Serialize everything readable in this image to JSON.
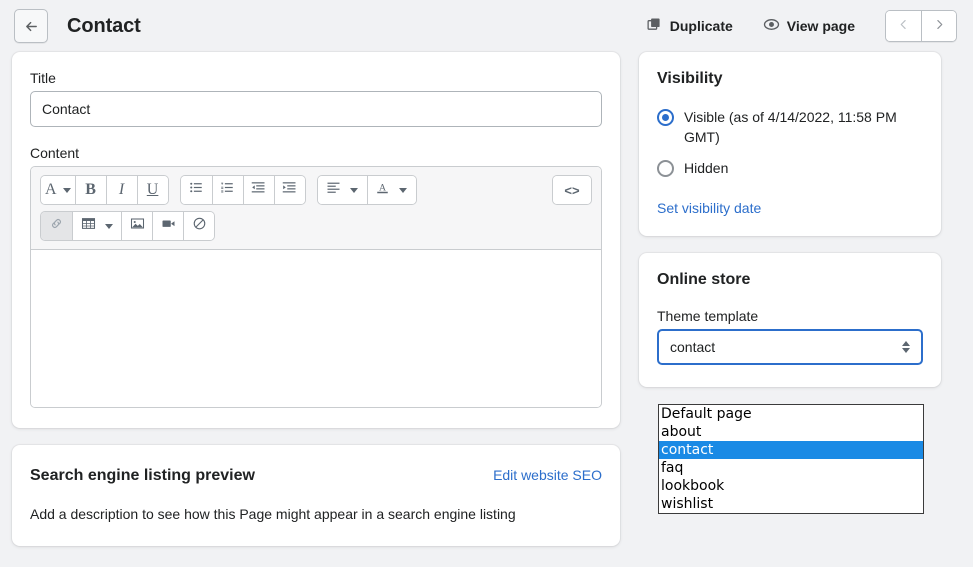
{
  "topbar": {
    "back_icon": "arrow-left-icon",
    "title": "Contact",
    "duplicate_label": "Duplicate",
    "duplicate_icon": "duplicate-icon",
    "view_page_label": "View page",
    "view_page_icon": "eye-icon",
    "prev_icon": "chevron-left-icon",
    "next_icon": "chevron-right-icon"
  },
  "main": {
    "title_label": "Title",
    "title_value": "Contact",
    "content_label": "Content",
    "editor": {
      "row1": [
        {
          "name": "font-style-button",
          "glyph": "A",
          "has_caret": true
        },
        {
          "name": "bold-button",
          "glyph": "B"
        },
        {
          "name": "italic-button",
          "glyph": "I"
        },
        {
          "name": "underline-button",
          "glyph": "U"
        },
        {
          "name": "bulleted-list-button",
          "glyph": "bulleted-list-icon"
        },
        {
          "name": "numbered-list-button",
          "glyph": "numbered-list-icon"
        },
        {
          "name": "outdent-button",
          "glyph": "outdent-icon"
        },
        {
          "name": "indent-button",
          "glyph": "indent-icon"
        },
        {
          "name": "align-button",
          "glyph": "align-left-icon",
          "has_caret": true
        },
        {
          "name": "text-color-button",
          "glyph": "text-color-icon",
          "has_caret": true
        },
        {
          "name": "code-view-button",
          "glyph": "<>"
        }
      ],
      "row2": [
        {
          "name": "insert-link-button",
          "glyph": "link-icon",
          "disabled": true
        },
        {
          "name": "insert-table-button",
          "glyph": "table-icon",
          "has_caret": true
        },
        {
          "name": "insert-image-button",
          "glyph": "image-icon"
        },
        {
          "name": "insert-video-button",
          "glyph": "video-icon"
        },
        {
          "name": "clear-formatting-button",
          "glyph": "no-symbol-icon"
        }
      ],
      "body_value": ""
    }
  },
  "seo": {
    "title": "Search engine listing preview",
    "edit_link": "Edit website SEO",
    "description": "Add a description to see how this Page might appear in a search engine listing"
  },
  "visibility": {
    "title": "Visibility",
    "options": [
      {
        "label": "Visible (as of 4/14/2022, 11:58 PM GMT)",
        "checked": true
      },
      {
        "label": "Hidden",
        "checked": false
      }
    ],
    "set_date_link": "Set visibility date"
  },
  "online_store": {
    "title": "Online store",
    "template_label": "Theme template",
    "template_value": "contact",
    "template_options": [
      "Default page",
      "about",
      "contact",
      "faq",
      "lookbook",
      "wishlist"
    ],
    "selected_option": "contact"
  },
  "colors": {
    "page_bg": "#f1f2f4",
    "card_bg": "#ffffff",
    "accent_blue": "#2c6ecb",
    "dropdown_highlight": "#1a8ae5",
    "text": "#202223",
    "border": "#c9cccf"
  }
}
